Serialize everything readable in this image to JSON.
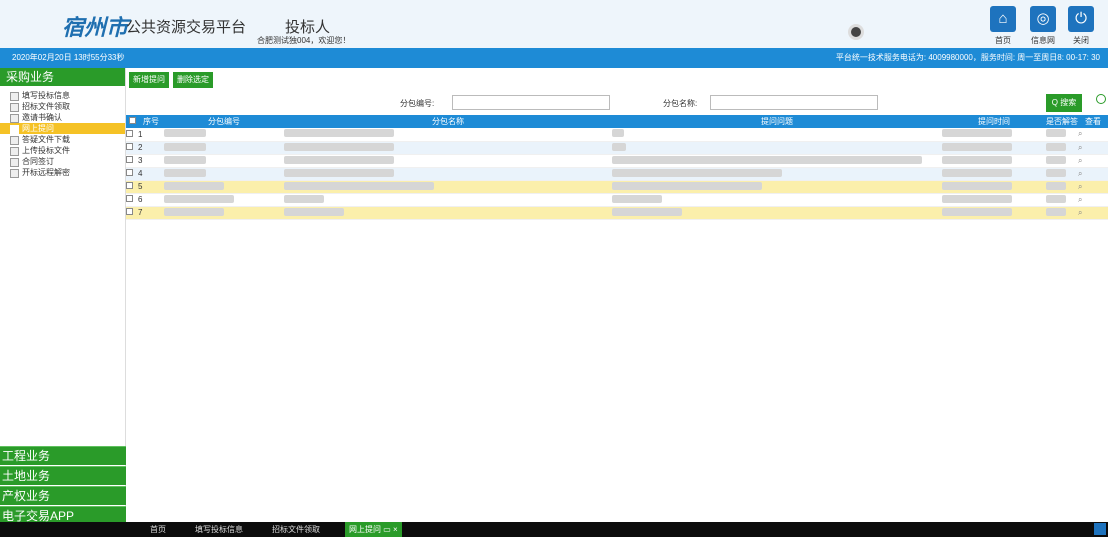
{
  "header": {
    "logo_text": "宿州市",
    "platform": "公共资源交易平台",
    "role": "投标人",
    "welcome": "合肥测试独004，欢迎您！",
    "home": "首页",
    "info": "信息网",
    "close": "关闭"
  },
  "bar": {
    "clock": "2020年02月20日 13时55分33秒",
    "hotline": "平台统一技术服务电话为: 4009980000，服务时间: 周一至周日8: 00-17: 30"
  },
  "sidebar": {
    "title": "采购业务",
    "items": [
      "填写投标信息",
      "招标文件领取",
      "邀请书确认",
      "网上提问",
      "答疑文件下载",
      "上传投标文件",
      "合同签订",
      "开标远程解密"
    ],
    "footer": [
      "工程业务",
      "土地业务",
      "产权业务",
      "电子交易APP"
    ]
  },
  "actions": {
    "add": "新增提问",
    "del": "删除选定"
  },
  "filters": {
    "pkg_no_label": "分包编号:",
    "pkg_name_label": "分包名称:",
    "search": "搜索"
  },
  "table": {
    "headers": [
      "序号",
      "分包编号",
      "分包名称",
      "提问问题",
      "提问时间",
      "是否解答",
      "查看"
    ],
    "rows": [
      "1",
      "2",
      "3",
      "4",
      "5",
      "6",
      "7"
    ]
  },
  "footer": {
    "tabs": [
      "首页",
      "填写投标信息",
      "招标文件领取",
      "网上提问"
    ]
  }
}
